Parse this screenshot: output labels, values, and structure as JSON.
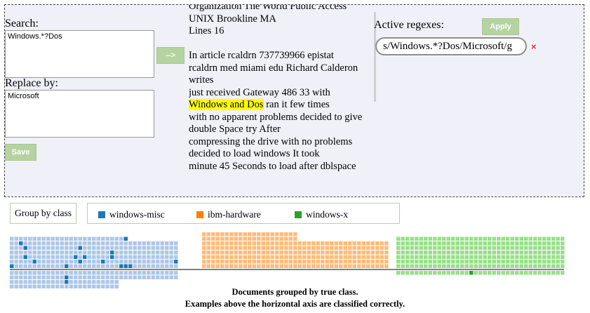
{
  "search": {
    "label": "Search:",
    "value": "Windows.*?Dos"
  },
  "replace": {
    "label": "Replace by:",
    "value": "Microsoft"
  },
  "buttons": {
    "save": "Save",
    "arrow": "-->",
    "apply": "Apply"
  },
  "document": {
    "lines": [
      "Organization The World Public Access",
      "UNIX Brookline MA",
      "Lines 16",
      "",
      "In article rcaldrn 737739966 epistat",
      "rcaldrn med miami edu Richard Calderon",
      "writes",
      "just received Gateway 486 33 with",
      "",
      "with no apparent problems decided to give",
      "double Space try After",
      "compressing the drive with no problems",
      "decided to load windows It took",
      "minute 45 Seconds to load after dblspace"
    ],
    "highlight_match": "Windows and Dos",
    "highlight_rest": " ran it few times"
  },
  "regexes": {
    "label": "Active regexes:",
    "items": [
      "s/Windows.*?Dos/Microsoft/g"
    ],
    "remove_symbol": "×"
  },
  "group_toggle": {
    "label": "Group by class"
  },
  "legend": [
    {
      "name": "windows-misc",
      "color": "#1f77b4"
    },
    {
      "name": "ibm-hardware",
      "color": "#ff7f0e"
    },
    {
      "name": "windows-x",
      "color": "#2ca02c"
    }
  ],
  "grid_colors": {
    "windows-misc": {
      "light": "#aec7e8",
      "dark": "#1f77b4"
    },
    "ibm-hardware": {
      "light": "#ffbb78",
      "dark": "#ff7f0e"
    },
    "windows-x": {
      "light": "#98df8a",
      "dark": "#2ca02c"
    }
  },
  "caption": {
    "line1": "Documents grouped by true class.",
    "line2": "Examples above the horizontal axis are classified correctly."
  }
}
